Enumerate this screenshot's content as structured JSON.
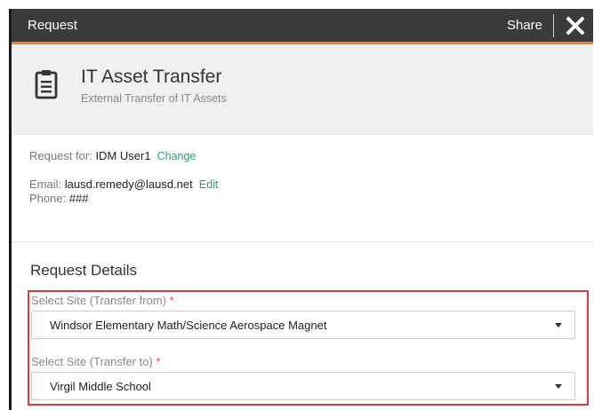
{
  "titlebar": {
    "title": "Request",
    "share_label": "Share"
  },
  "header": {
    "title": "IT Asset Transfer",
    "subtitle": "External Transfer of IT Assets",
    "icon": "clipboard-icon"
  },
  "request_for": {
    "label": "Request for: ",
    "value": "IDM User1",
    "link": "Change"
  },
  "email": {
    "label": "Email: ",
    "value": "lausd.remedy@lausd.net",
    "link": "Edit"
  },
  "phone": {
    "label": "Phone: ",
    "value": "###"
  },
  "details": {
    "title": "Request Details",
    "from": {
      "label": "Select Site (Transfer from)",
      "required_mark": "*",
      "value": "Windsor Elementary Math/Science Aerospace Magnet"
    },
    "to": {
      "label": "Select Site (Transfer to)",
      "required_mark": "*",
      "value": "Virgil Middle School"
    }
  },
  "colors": {
    "accent": "#f0812a",
    "link": "#1aa47f",
    "highlight": "#d93a3a",
    "required": "#e0481f"
  }
}
